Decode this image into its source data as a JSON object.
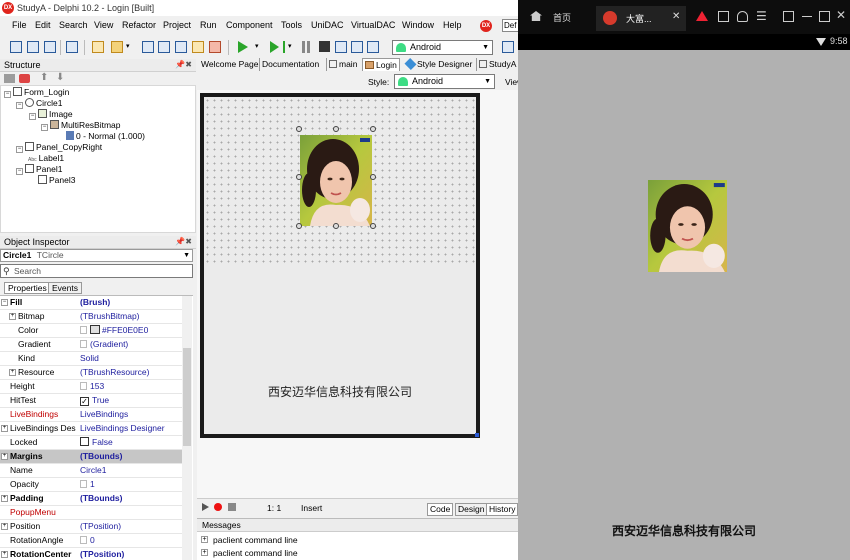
{
  "window": {
    "title": "StudyA - Delphi 10.2 - Login [Built]",
    "logo_text": "DX"
  },
  "menu": [
    "File",
    "Edit",
    "Search",
    "View",
    "Refactor",
    "Project",
    "Run",
    "Component",
    "Tools",
    "UniDAC",
    "VirtualDAC",
    "Window",
    "Help"
  ],
  "menu_right_badge": "DX",
  "menu_right_text": "Def",
  "toolbar": {
    "platform": "Android"
  },
  "structure": {
    "title": "Structure",
    "items": [
      {
        "label": "Form_Login",
        "level": 0
      },
      {
        "label": "Circle1",
        "level": 1
      },
      {
        "label": "Image",
        "level": 2
      },
      {
        "label": "MultiResBitmap",
        "level": 3
      },
      {
        "label": "0 - Normal (1.000)",
        "level": 4
      },
      {
        "label": "Panel_CopyRight",
        "level": 1
      },
      {
        "label": "Label1",
        "level": 2
      },
      {
        "label": "Panel1",
        "level": 1
      },
      {
        "label": "Panel3",
        "level": 2
      }
    ],
    "label_badge": "Abc"
  },
  "inspector": {
    "title": "Object Inspector",
    "selected_name": "Circle1",
    "selected_type": "TCircle",
    "search_placeholder": "Search",
    "tabs": [
      "Properties",
      "Events"
    ],
    "rows": [
      {
        "name": "Fill",
        "value": "(Brush)",
        "expand": "minus",
        "bold": true
      },
      {
        "name": "Bitmap",
        "value": "(TBrushBitmap)",
        "expand": "plus",
        "indent": true
      },
      {
        "name": "Color",
        "value": "#FFE0E0E0",
        "indent": true,
        "swatch": "#e0e0e0"
      },
      {
        "name": "Gradient",
        "value": "(Gradient)",
        "indent": true
      },
      {
        "name": "Kind",
        "value": "Solid",
        "indent": true
      },
      {
        "name": "Resource",
        "value": "(TBrushResource)",
        "expand": "plus",
        "indent": true
      },
      {
        "name": "Height",
        "value": "153"
      },
      {
        "name": "HitTest",
        "value": "True",
        "check": "✓"
      },
      {
        "name": "LiveBindings",
        "value": "LiveBindings",
        "red": true
      },
      {
        "name": "LiveBindings Designer",
        "value": "LiveBindings Designer",
        "expand": "plus"
      },
      {
        "name": "Locked",
        "value": "False",
        "check": ""
      },
      {
        "name": "Margins",
        "value": "(TBounds)",
        "expand": "plus",
        "bold": true,
        "selected": true
      },
      {
        "name": "Name",
        "value": "Circle1"
      },
      {
        "name": "Opacity",
        "value": "1"
      },
      {
        "name": "Padding",
        "value": "(TBounds)",
        "expand": "plus",
        "bold": true
      },
      {
        "name": "PopupMenu",
        "value": "",
        "red": true
      },
      {
        "name": "Position",
        "value": "(TPosition)",
        "expand": "plus"
      },
      {
        "name": "RotationAngle",
        "value": "0"
      },
      {
        "name": "RotationCenter",
        "value": "(TPosition)",
        "expand": "plus",
        "bold": true
      }
    ]
  },
  "editor": {
    "tabs": [
      "Welcome Page",
      "Documentation",
      "main",
      "Login",
      "Style Designer",
      "StudyA"
    ],
    "active_tab": "Login",
    "style_label": "Style:",
    "style_value": "Android",
    "view_label": "View",
    "copyright_text": "西安迈华信息科技有限公司"
  },
  "status": {
    "position": "1:   1",
    "mode": "Insert",
    "tabs": [
      "Code",
      "Design",
      "History"
    ]
  },
  "messages": {
    "title": "Messages",
    "rows": [
      "paclient command line",
      "paclient command line"
    ]
  },
  "emulator": {
    "home_tab": "首页",
    "app_tab": "大富...",
    "time": "9:58",
    "copyright_text": "西安迈华信息科技有限公司"
  }
}
